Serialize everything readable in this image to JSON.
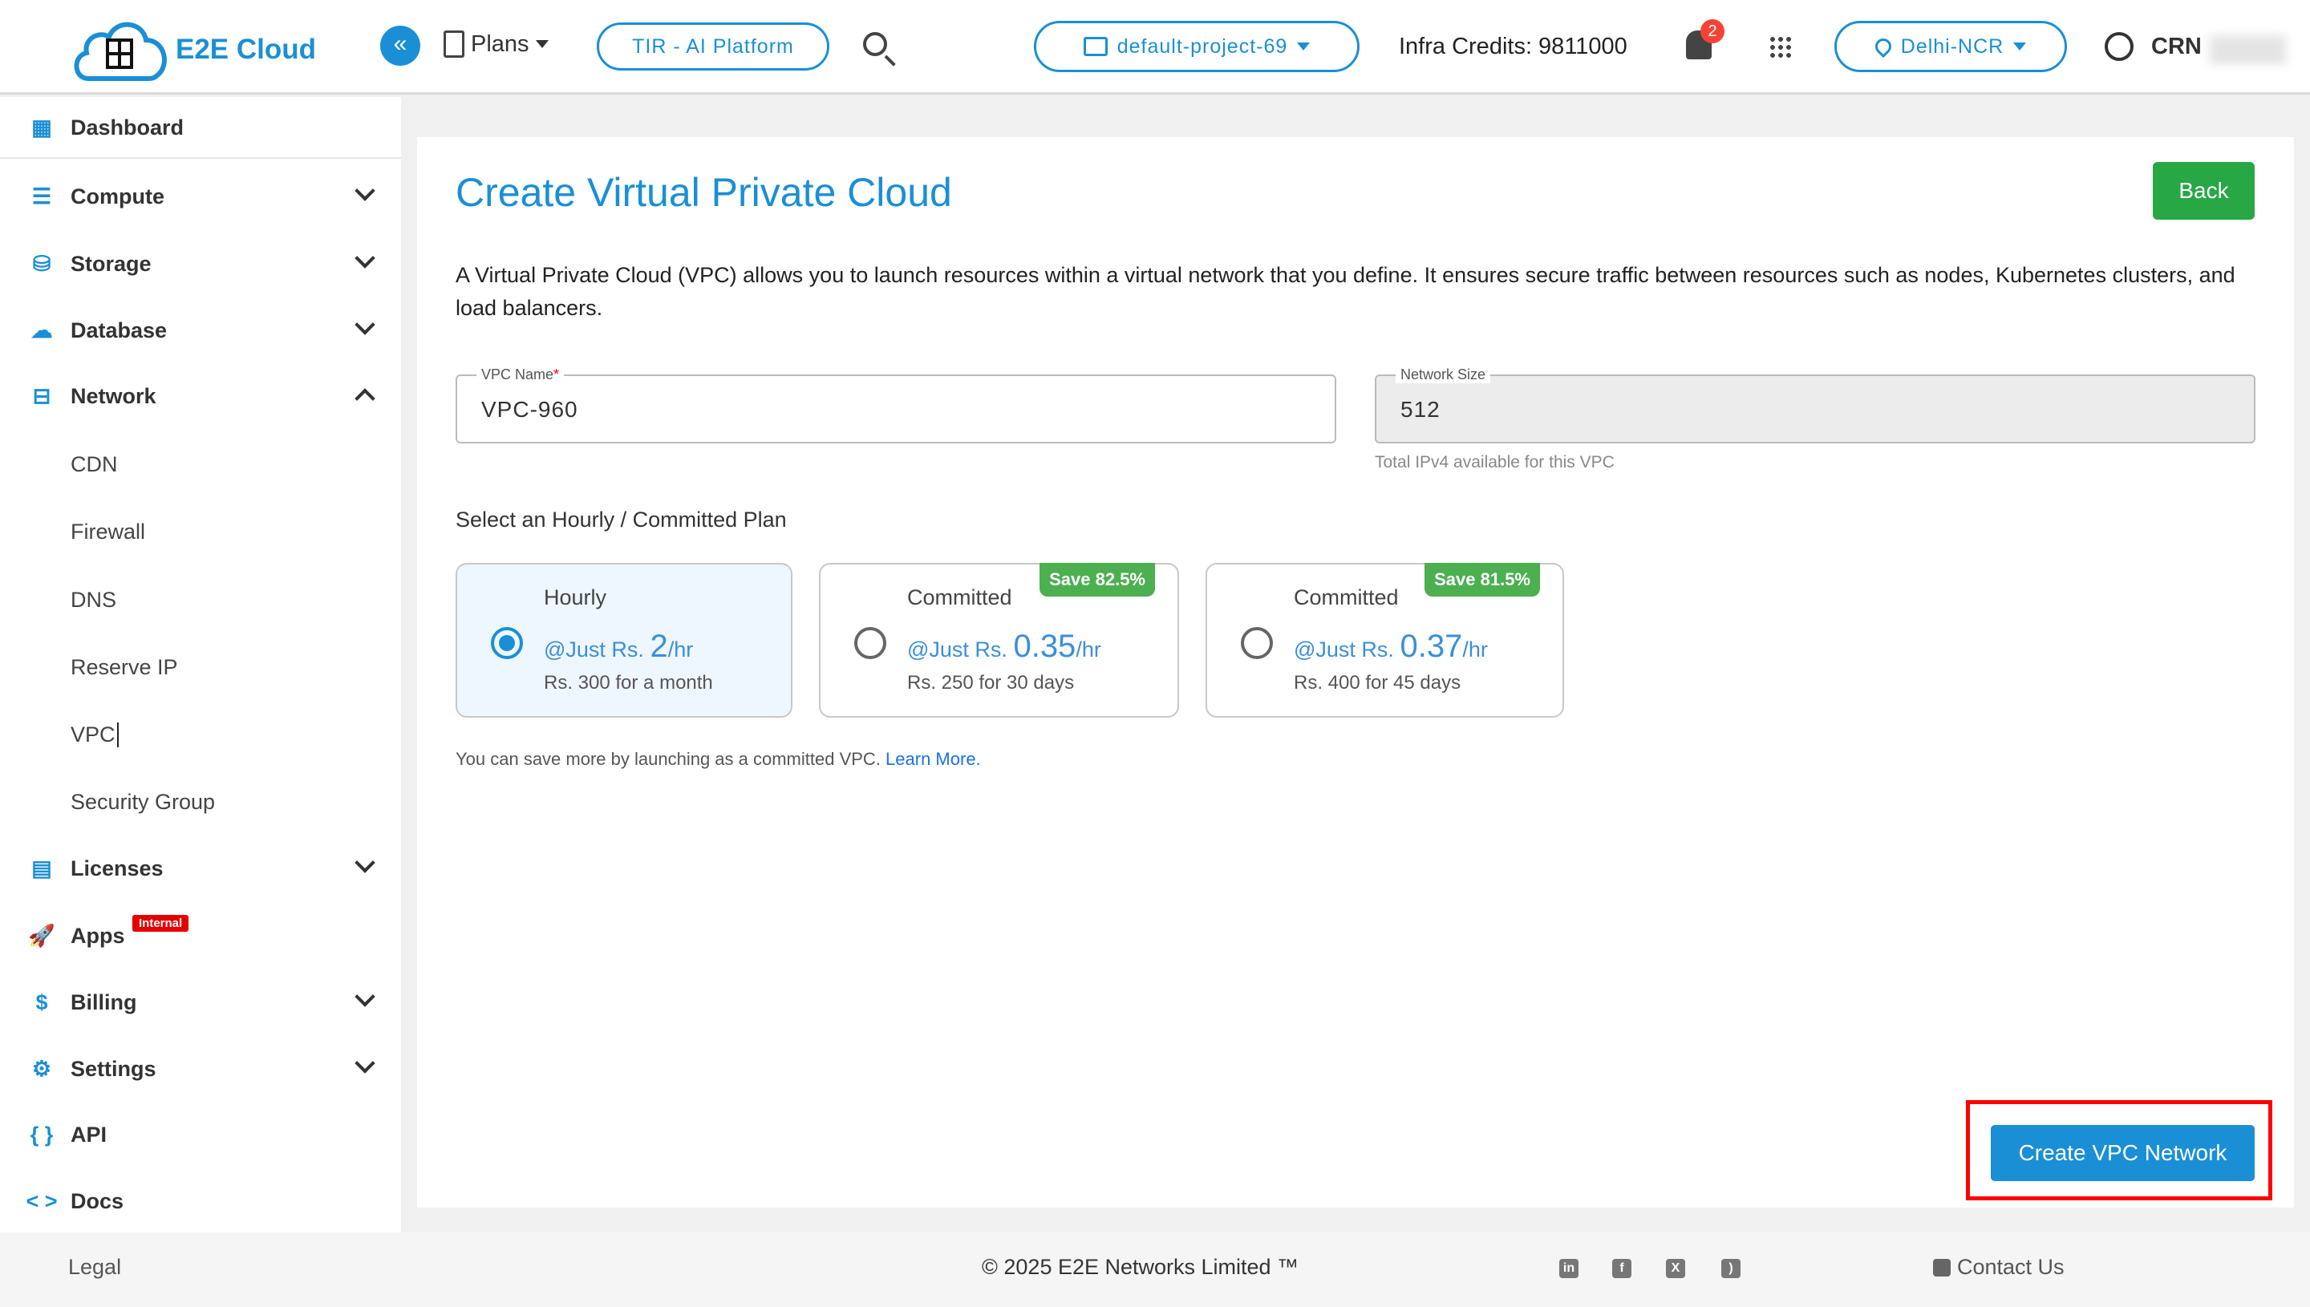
{
  "header": {
    "brand": "E2E Cloud",
    "logo_text": "E2E Cloud",
    "plans_label": "Plans",
    "tir_label": "TIR - AI Platform",
    "project": "default-project-69",
    "credits": "Infra Credits: 9811000",
    "notification_count": "2",
    "region": "Delhi-NCR",
    "user_label": "CRN"
  },
  "sidebar": {
    "items": [
      {
        "label": "Dashboard",
        "icon": "dashboard-icon"
      },
      {
        "label": "Compute",
        "icon": "server-icon"
      },
      {
        "label": "Storage",
        "icon": "storage-icon"
      },
      {
        "label": "Database",
        "icon": "database-icon"
      },
      {
        "label": "Network",
        "icon": "network-icon",
        "expanded": true
      },
      {
        "label": "Licenses",
        "icon": "licenses-icon"
      },
      {
        "label": "Apps",
        "icon": "rocket-icon",
        "badge": "Internal"
      },
      {
        "label": "Billing",
        "icon": "billing-icon"
      },
      {
        "label": "Settings",
        "icon": "gear-icon"
      },
      {
        "label": "API",
        "icon": "braces-icon"
      },
      {
        "label": "Docs",
        "icon": "code-icon"
      }
    ],
    "network_sub": [
      "CDN",
      "Firewall",
      "DNS",
      "Reserve IP",
      "VPC",
      "Security Group"
    ]
  },
  "main": {
    "title": "Create Virtual Private Cloud",
    "back_label": "Back",
    "description": "A Virtual Private Cloud (VPC) allows you to launch resources within a virtual network that you define. It ensures secure traffic between resources such as nodes, Kubernetes clusters, and load balancers.",
    "vpc_name_label": "VPC Name",
    "vpc_name_value": "VPC-960",
    "network_size_label": "Network Size",
    "network_size_value": "512",
    "network_size_help": "Total IPv4 available for this VPC",
    "plan_heading": "Select an Hourly / Committed Plan",
    "plans": [
      {
        "title": "Hourly",
        "prefix": "@Just Rs.",
        "price": "2",
        "unit": "/hr",
        "detail": "Rs. 300 for a month",
        "selected": true
      },
      {
        "title": "Committed",
        "prefix": "@Just Rs.",
        "price": "0.35",
        "unit": "/hr",
        "detail": "Rs. 250 for 30 days",
        "badge": "Save 82.5%",
        "selected": false
      },
      {
        "title": "Committed",
        "prefix": "@Just Rs.",
        "price": "0.37",
        "unit": "/hr",
        "detail": "Rs. 400 for 45 days",
        "badge": "Save 81.5%",
        "selected": false
      }
    ],
    "note": "You can save more by launching as a committed VPC.",
    "learn_more": "Learn More.",
    "create_label": "Create VPC Network"
  },
  "footer": {
    "legal": "Legal",
    "copyright": "© 2025 E2E Networks Limited ™",
    "contact": "Contact Us"
  },
  "colors": {
    "accent": "#1a8fd6",
    "success": "#4caf50",
    "highlight": "#ff0000"
  }
}
